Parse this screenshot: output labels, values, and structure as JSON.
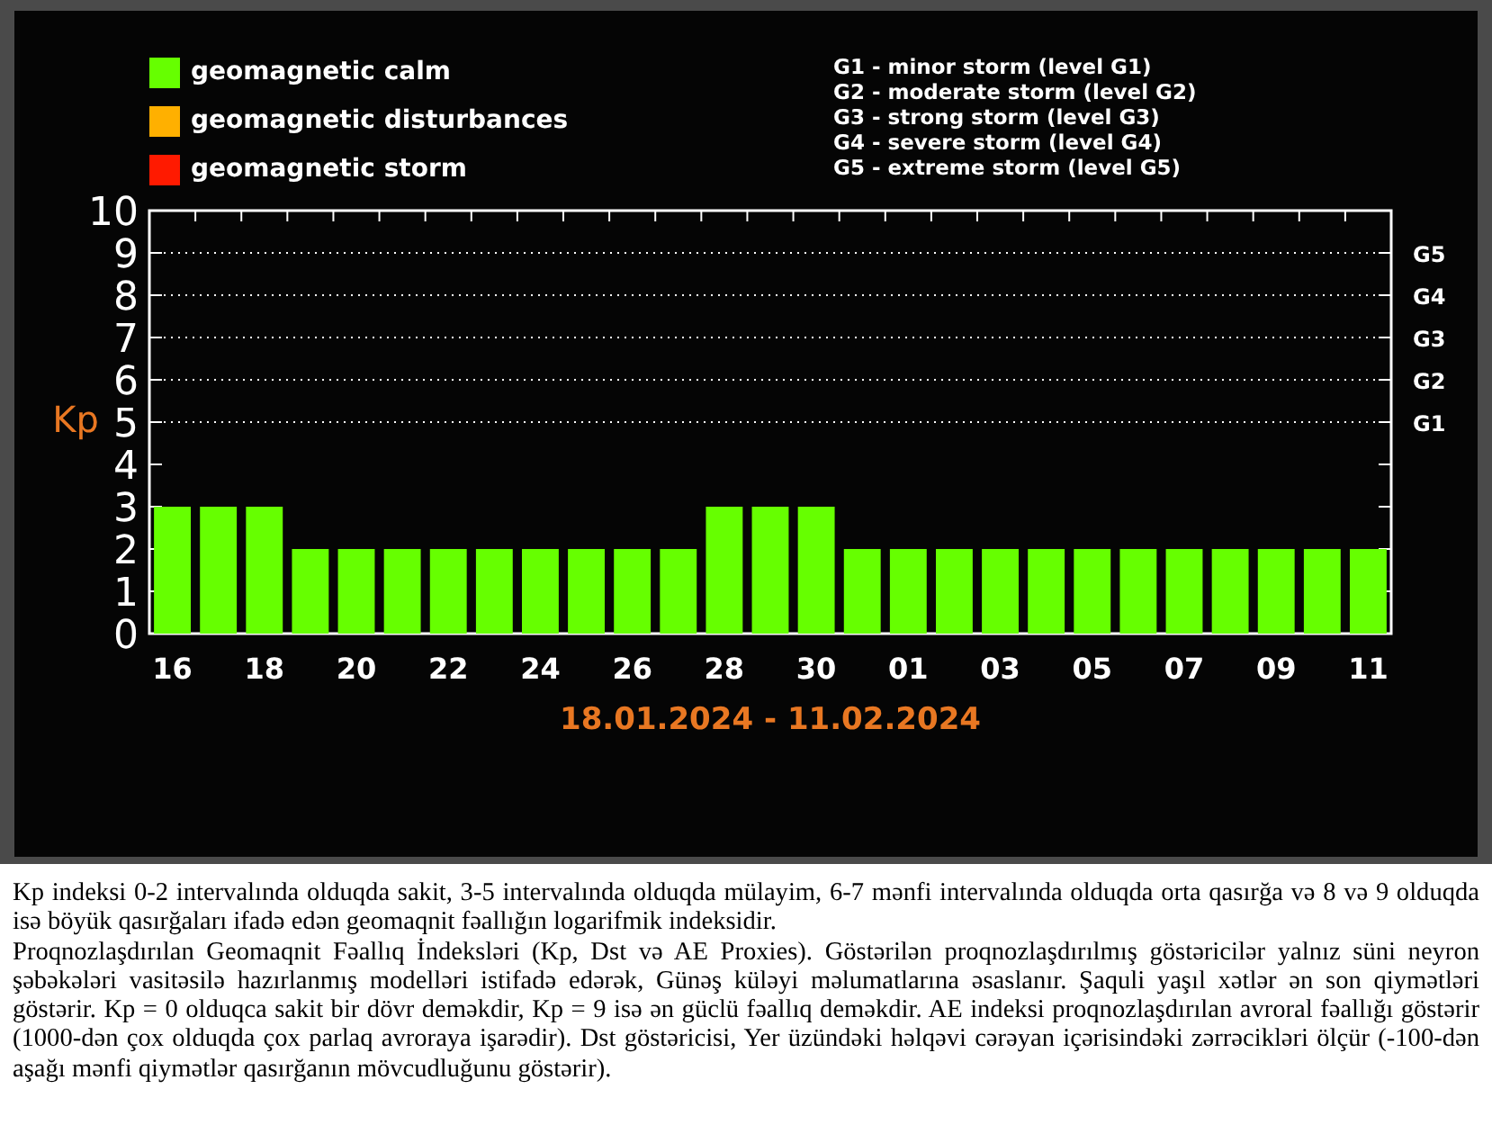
{
  "legend": [
    {
      "label": "geomagnetic calm",
      "color": "#66ff00"
    },
    {
      "label": "geomagnetic disturbances",
      "color": "#ffb000"
    },
    {
      "label": "geomagnetic storm",
      "color": "#ff1a00"
    }
  ],
  "storm_levels": [
    "G1 - minor storm (level G1)",
    "G2 - moderate storm (level G2)",
    "G3 - strong storm (level G3)",
    "G4 - severe storm (level G4)",
    "G5 - extreme storm (level G5)"
  ],
  "chart": {
    "chart_data": {
      "type": "bar",
      "ylabel": "Kp",
      "xlabel": "18.01.2024 - 11.02.2024",
      "categories": [
        "16",
        null,
        "18",
        null,
        "20",
        null,
        "22",
        null,
        "24",
        null,
        "26",
        null,
        "28",
        null,
        "30",
        null,
        "01",
        null,
        "03",
        null,
        "05",
        null,
        "07",
        null,
        "09",
        null,
        "11"
      ],
      "series": [
        {
          "color": "#66ff00",
          "values": [
            3,
            3,
            3,
            2,
            2,
            2,
            2,
            2,
            2,
            2,
            2,
            2,
            3,
            3,
            3,
            2,
            2,
            2,
            2,
            2,
            2,
            2,
            2,
            2,
            2,
            2,
            2
          ]
        }
      ],
      "ylim": [
        0,
        10
      ],
      "yticks": [
        0,
        1,
        2,
        3,
        4,
        5,
        6,
        7,
        8,
        9,
        10
      ],
      "grid": true
    },
    "right_axis_labels": [
      "G5",
      "G4",
      "G3",
      "G2",
      "G1"
    ]
  },
  "paragraphs": [
    "Kp indeksi 0-2 intervalında olduqda sakit, 3-5 intervalında olduqda mülayim, 6-7 mənfi intervalında olduqda orta qasırğa və 8 və 9 olduqda isə böyük qasırğaları ifadə edən geomaqnit fəallığın logarifmik indeksidir.",
    "Proqnozlaşdırılan Geomaqnit Fəallıq İndeksləri (Kp, Dst və AE Proxies). Göstərilən proqnozlaşdırılmış göstəricilər yalnız süni neyron şəbəkələri vasitəsilə hazırlanmış modelləri istifadə edərək, Günəş küləyi məlumatlarına əsaslanır. Şaquli yaşıl xətlər ən son qiymətləri göstərir. Kp = 0 olduqca sakit bir dövr deməkdir, Kp = 9 isə ən güclü fəallıq deməkdir. AE indeksi proqnozlaşdırılan avroral fəallığı göstərir (1000-dən çox olduqda çox parlaq avroraya işarədir). Dst göstəricisi, Yer üzündəki həlqəvi cərəyan içərisindəki zərrəcikləri ölçür (-100-dən aşağı mənfi qiymətlər qasırğanın mövcudluğunu göstərir)."
  ]
}
